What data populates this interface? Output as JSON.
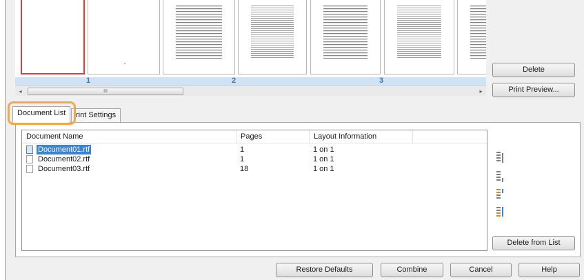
{
  "preview": {
    "groups": [
      {
        "label": "1"
      },
      {
        "label": "2"
      },
      {
        "label": "3"
      }
    ]
  },
  "scrollbar": {
    "thumb_label": "III",
    "left_arrow": "◂",
    "right_arrow": "▸"
  },
  "right_buttons": {
    "delete": "Delete",
    "print_preview": "Print Preview..."
  },
  "tabs": [
    {
      "label": "Document List",
      "active": true
    },
    {
      "label": "rint Settings",
      "active": false
    }
  ],
  "document_list": {
    "columns": [
      "Document Name",
      "Pages",
      "Layout Information"
    ],
    "rows": [
      {
        "name": "Document01.rtf",
        "pages": "1",
        "layout": "1 on 1",
        "selected": true
      },
      {
        "name": "Document02.rtf",
        "pages": "1",
        "layout": "1 on 1",
        "selected": false
      },
      {
        "name": "Document03.rtf",
        "pages": "18",
        "layout": "1 on 1",
        "selected": false
      }
    ]
  },
  "order_icons": [
    "move-to-top-icon",
    "move-up-icon",
    "move-down-icon",
    "move-to-bottom-icon"
  ],
  "delete_from_list": "Delete from List",
  "bottom_buttons": {
    "restore_defaults": "Restore Defaults",
    "combine": "Combine",
    "cancel": "Cancel",
    "help": "Help"
  },
  "colors": {
    "selection": "#3a84d6",
    "group_label": "#3b78b5",
    "highlight": "#f0a848",
    "selected_page_border": "#e23a3a"
  }
}
